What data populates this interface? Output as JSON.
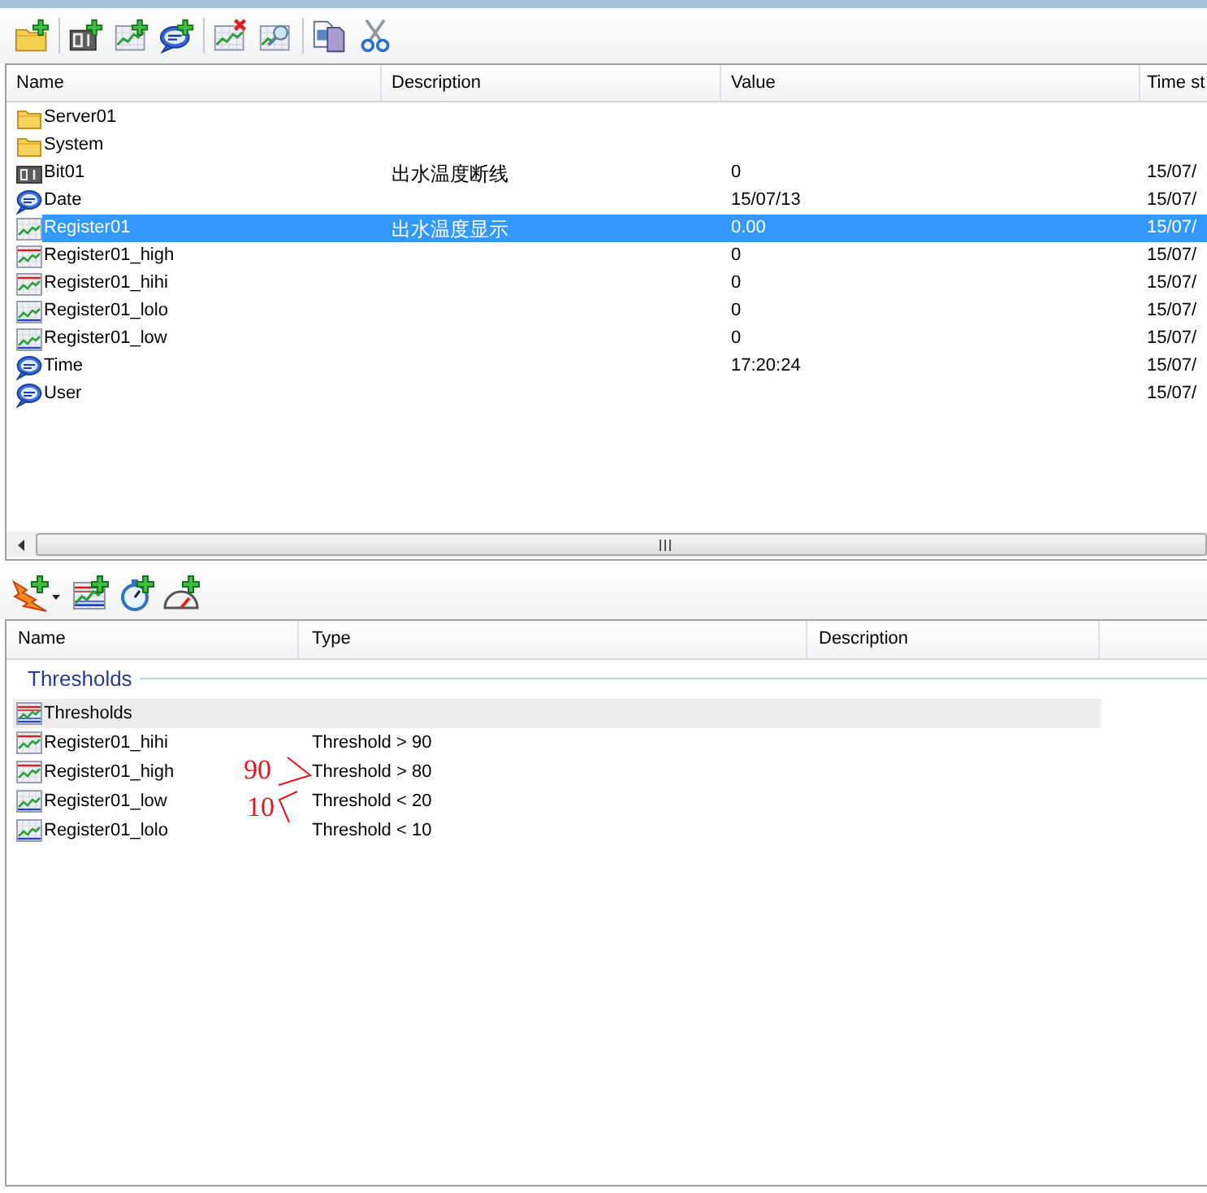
{
  "variables_list": {
    "columns": [
      "Name",
      "Description",
      "Value",
      "Time st"
    ],
    "rows": [
      {
        "kind": "folder",
        "name": "Server01",
        "selected": false
      },
      {
        "kind": "folder",
        "name": "System",
        "selected": false
      },
      {
        "kind": "digital",
        "name": "Bit01",
        "description": "出水温度断线",
        "value": "0",
        "time": "15/07/",
        "selected": false
      },
      {
        "kind": "text",
        "name": "Date",
        "value": "15/07/13",
        "time": "15/07/",
        "selected": false
      },
      {
        "kind": "analog",
        "name": "Register01",
        "description": "出水温度显示",
        "value": "0.00",
        "time": "15/07/",
        "selected": true
      },
      {
        "kind": "high_limit",
        "name": "Register01_high",
        "value": "0",
        "time": "15/07/",
        "selected": false
      },
      {
        "kind": "high_limit",
        "name": "Register01_hihi",
        "value": "0",
        "time": "15/07/",
        "selected": false
      },
      {
        "kind": "low_limit",
        "name": "Register01_lolo",
        "value": "0",
        "time": "15/07/",
        "selected": false
      },
      {
        "kind": "low_limit",
        "name": "Register01_low",
        "value": "0",
        "time": "15/07/",
        "selected": false
      },
      {
        "kind": "text",
        "name": "Time",
        "value": "17:20:24",
        "time": "15/07/",
        "selected": false
      },
      {
        "kind": "text",
        "name": "User",
        "time": "15/07/",
        "selected": false
      }
    ]
  },
  "thresholds_list": {
    "columns": [
      "Name",
      "Type",
      "Description"
    ],
    "group_label": "Thresholds",
    "rows": [
      {
        "kind": "group",
        "name": "Thresholds",
        "selected": true
      },
      {
        "kind": "high_limit",
        "name": "Register01_hihi",
        "type": "Threshold > 90",
        "selected": false
      },
      {
        "kind": "high_limit",
        "name": "Register01_high",
        "type": "Threshold > 80",
        "selected": false,
        "annotation": {
          "text": "90",
          "kind": "chevron_right"
        }
      },
      {
        "kind": "low_limit",
        "name": "Register01_low",
        "type": "Threshold < 20",
        "selected": false,
        "annotation": {
          "text": "10",
          "kind": "chevron_left"
        }
      },
      {
        "kind": "low_limit",
        "name": "Register01_lolo",
        "type": "Threshold < 10",
        "selected": false
      }
    ]
  }
}
